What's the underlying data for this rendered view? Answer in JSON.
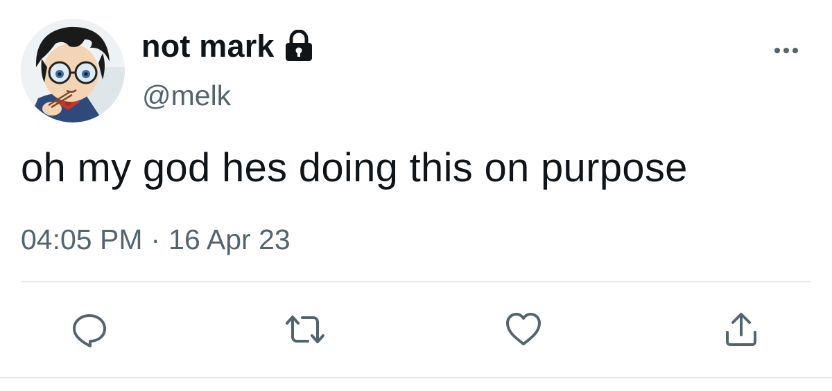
{
  "tweet": {
    "author": {
      "display_name": "not mark",
      "handle": "@melk",
      "protected_icon": "lock-icon",
      "avatar": "anime-character-avatar"
    },
    "text": "oh my god hes doing this on purpose",
    "time": "04:05 PM",
    "separator": "·",
    "date": "16 Apr 23"
  },
  "header": {
    "more_icon": "more-horizontal-icon"
  },
  "actions": [
    {
      "name": "reply",
      "icon": "reply-icon"
    },
    {
      "name": "retweet",
      "icon": "retweet-icon"
    },
    {
      "name": "like",
      "icon": "heart-icon"
    },
    {
      "name": "share",
      "icon": "share-icon"
    }
  ],
  "colors": {
    "text_primary": "#0f1419",
    "text_secondary": "#536471",
    "divider": "#e7eaec",
    "background": "#ffffff"
  }
}
